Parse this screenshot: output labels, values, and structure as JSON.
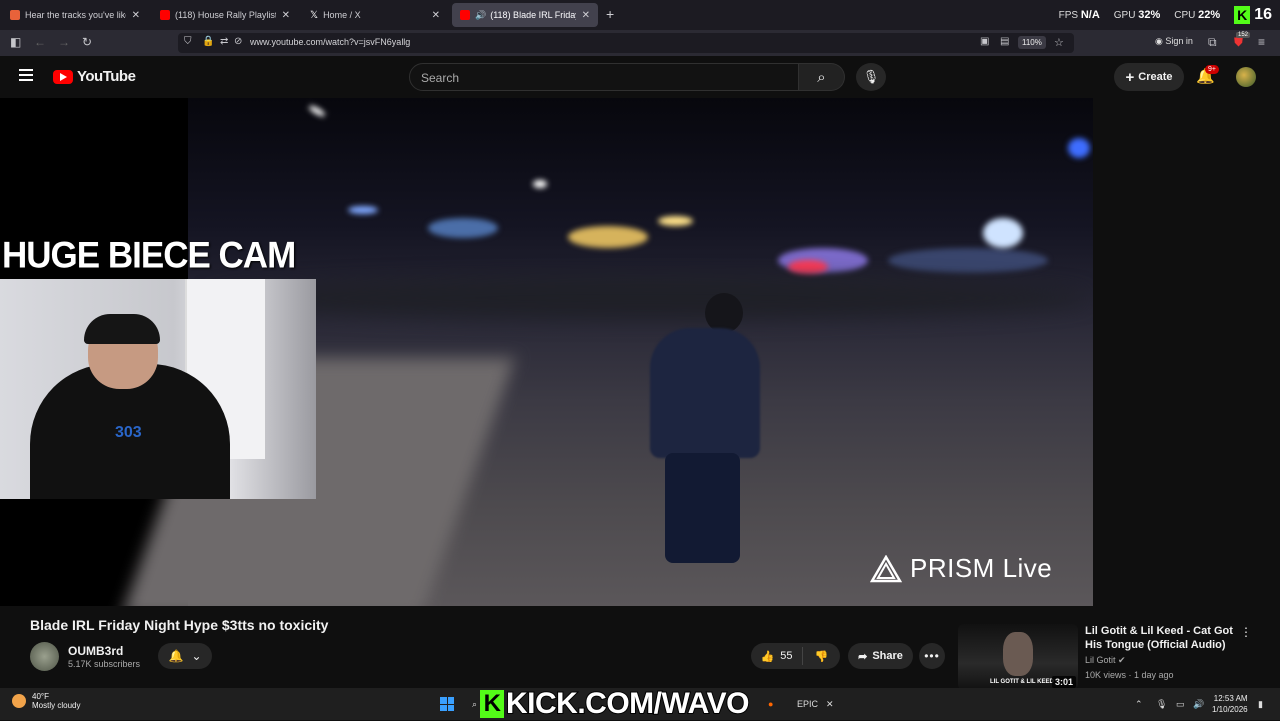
{
  "browser": {
    "tabs": [
      {
        "title": "Hear the tracks you've liked: on",
        "active": false,
        "color": "#e8623a"
      },
      {
        "title": "(118) House Rally Playlist - You",
        "active": false,
        "color": "#ff0000"
      },
      {
        "title": "Home / X",
        "active": false,
        "color": "#ffffff"
      },
      {
        "title": "(118) Blade IRL Friday Night",
        "active": true,
        "color": "#ff0000"
      }
    ],
    "url": "www.youtube.com/watch?v=jsvFN6yallg",
    "zoom": "110%",
    "signin": "Sign in",
    "ext_badge": "152"
  },
  "overlay_stats": {
    "fps_label": "FPS",
    "fps_value": "N/A",
    "gpu_label": "GPU",
    "gpu_value": "32%",
    "cpu_label": "CPU",
    "cpu_value": "22%",
    "kick_count": "16"
  },
  "youtube": {
    "logo_text": "YouTube",
    "search_placeholder": "Search",
    "create_label": "Create",
    "notif_badge": "9+"
  },
  "video": {
    "cam_title": "HUGE BIECE CAM",
    "watermark": "PRISM Live",
    "webcam_shirt": "303"
  },
  "watch": {
    "title": "Blade IRL Friday Night Hype $3tts no toxicity",
    "channel": "OUMB3rd",
    "subscribers": "5.17K subscribers",
    "likes": "55",
    "share_label": "Share"
  },
  "related": {
    "title": "Lil Gotit & Lil Keed - Cat Got His Tongue (Official Audio)",
    "channel": "Lil Gotit",
    "meta": "10K views · 1 day ago",
    "duration": "3:01",
    "thumb_caption": "LIL GOTIT & LIL KEED"
  },
  "taskbar": {
    "temp": "40°F",
    "weather": "Mostly cloudy",
    "kick_banner": "KICK.COM/WAVO",
    "time": "12:53 AM",
    "date": "1/10/2026"
  }
}
